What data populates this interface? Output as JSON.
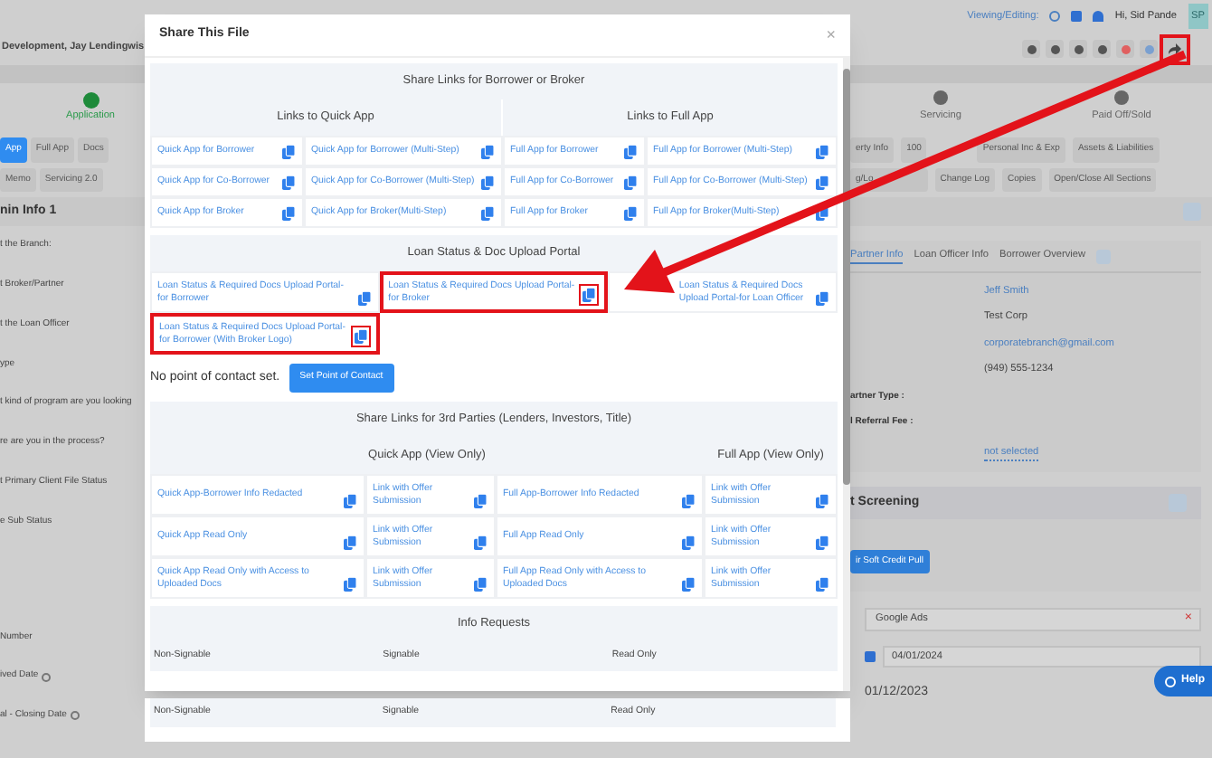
{
  "header": {
    "title": "Development, Jay Lendingwis",
    "viewing_label": "Viewing/Editing:",
    "greeting": "Hi, Sid Pande",
    "avatar": "SP",
    "share_highlighted": true
  },
  "steps": [
    {
      "label": "Application",
      "done": true
    },
    {
      "label": "Servicing",
      "done": false
    },
    {
      "label": "Paid Off/Sold",
      "done": false
    }
  ],
  "left_tabs": [
    {
      "label": "App",
      "selected": true
    },
    {
      "label": "Full App",
      "selected": false
    },
    {
      "label": "Docs",
      "selected": false
    }
  ],
  "left_tabs_2": [
    "Memo",
    "Servicing 2.0"
  ],
  "right_tabs": [
    "erty Info",
    "100",
    "Personal Inc & Exp",
    "Assets & Liabilities"
  ],
  "right_tabs_2": [
    "g/Lo",
    "Change Log",
    "Copies",
    "Open/Close All Sections"
  ],
  "section_title": "nin Info 1",
  "left_fields": [
    {
      "label": "t the Branch:",
      "info": false
    },
    {
      "label": "t Broker/Partner",
      "info": false
    },
    {
      "label": "t the Loan Officer",
      "info": false
    },
    {
      "label": "ype",
      "info": false
    },
    {
      "label": "t kind of program are you looking",
      "info": false
    },
    {
      "label": "re are you in the process?",
      "info": false
    },
    {
      "label": "t Primary Client File Status",
      "info": false
    },
    {
      "label": "e Sub Status",
      "info": false
    },
    {
      "label": "Number",
      "info": false
    },
    {
      "label": "ived Date",
      "info": true
    },
    {
      "label": "al - Closing Date",
      "info": true
    }
  ],
  "partner_tabs": [
    {
      "label": "Partner Info",
      "selected": true
    },
    {
      "label": "Loan Officer Info",
      "selected": false
    },
    {
      "label": "Borrower Overview",
      "selected": false
    }
  ],
  "partner_values": [
    {
      "text": "Jeff Smith",
      "kind": "link"
    },
    {
      "text": "Test Corp",
      "kind": "text"
    },
    {
      "text": "corporatebranch@gmail.com",
      "kind": "link"
    },
    {
      "text": "(949) 555-1234",
      "kind": "text"
    }
  ],
  "partner_labels": [
    "artner Type :",
    "l Referral Fee :"
  ],
  "partner_status": "not selected",
  "screening": {
    "title": "t Screening",
    "button": "ir Soft Credit Pull"
  },
  "source_field": {
    "value": "Google Ads",
    "clear": "×"
  },
  "date_field": {
    "value": "04/01/2024"
  },
  "closing_date": "01/12/2023",
  "help": "Help",
  "modal": {
    "title": "Share This File",
    "close": "×",
    "borrower": {
      "title": "Share Links for Borrower or Broker",
      "quick_title": "Links to Quick App",
      "full_title": "Links to Full App",
      "rows": [
        [
          {
            "label": "Quick App for Borrower",
            "highlighted": false
          },
          {
            "label": "Quick App for Borrower (Multi-Step)",
            "highlighted": false
          },
          {
            "label": "Full App for Borrower",
            "highlighted": false
          },
          {
            "label": "Full App for Borrower (Multi-Step)",
            "highlighted": false
          }
        ],
        [
          {
            "label": "Quick App for Co-Borrower",
            "highlighted": false
          },
          {
            "label": "Quick App for Co-Borrower (Multi-Step)",
            "highlighted": false
          },
          {
            "label": "Full App for Co-Borrower",
            "highlighted": false
          },
          {
            "label": "Full App for Co-Borrower (Multi-Step)",
            "highlighted": false
          }
        ],
        [
          {
            "label": "Quick App for Broker",
            "highlighted": false
          },
          {
            "label": "Quick App for Broker(Multi-Step)",
            "highlighted": false
          },
          {
            "label": "Full App for Broker",
            "highlighted": false
          },
          {
            "label": "Full App for Broker(Multi-Step)",
            "highlighted": false
          }
        ]
      ]
    },
    "portal": {
      "title": "Loan Status & Doc Upload Portal",
      "rows": [
        [
          {
            "label": "Loan Status & Required Docs Upload Portal-for Borrower",
            "highlighted": false
          },
          {
            "label": "Loan Status & Required Docs Upload Portal-for Broker",
            "highlighted": true
          },
          {
            "label": "Loan Status & Required Docs Upload Portal-for Loan Officer",
            "highlighted": false
          }
        ],
        [
          {
            "label": "Loan Status & Required Docs Upload Portal-for Borrower (With Broker Logo)",
            "highlighted": true
          }
        ]
      ]
    },
    "contact": {
      "message": "No point of contact set.",
      "button": "Set Point of Contact"
    },
    "third": {
      "title": "Share Links for 3rd Parties (Lenders, Investors, Title)",
      "quick_title": "Quick App (View Only)",
      "full_title": "Full App (View Only)",
      "rows": [
        [
          "Quick App-Borrower Info Redacted",
          "Link with Offer Submission",
          "Full App-Borrower Info Redacted",
          "Link with Offer Submission"
        ],
        [
          "Quick App Read Only",
          "Link with Offer Submission",
          "Full App Read Only",
          "Link with Offer Submission"
        ],
        [
          "Quick App Read Only with Access to Uploaded Docs",
          "Link with Offer Submission",
          "Full App Read Only with Access to Uploaded Docs",
          "Link with Offer Submission"
        ]
      ]
    },
    "info": {
      "title": "Info Requests",
      "columns": [
        "Non-Signable",
        "Signable",
        "Read Only"
      ]
    },
    "strip_columns": [
      "Non-Signable",
      "Signable",
      "Read Only"
    ]
  }
}
